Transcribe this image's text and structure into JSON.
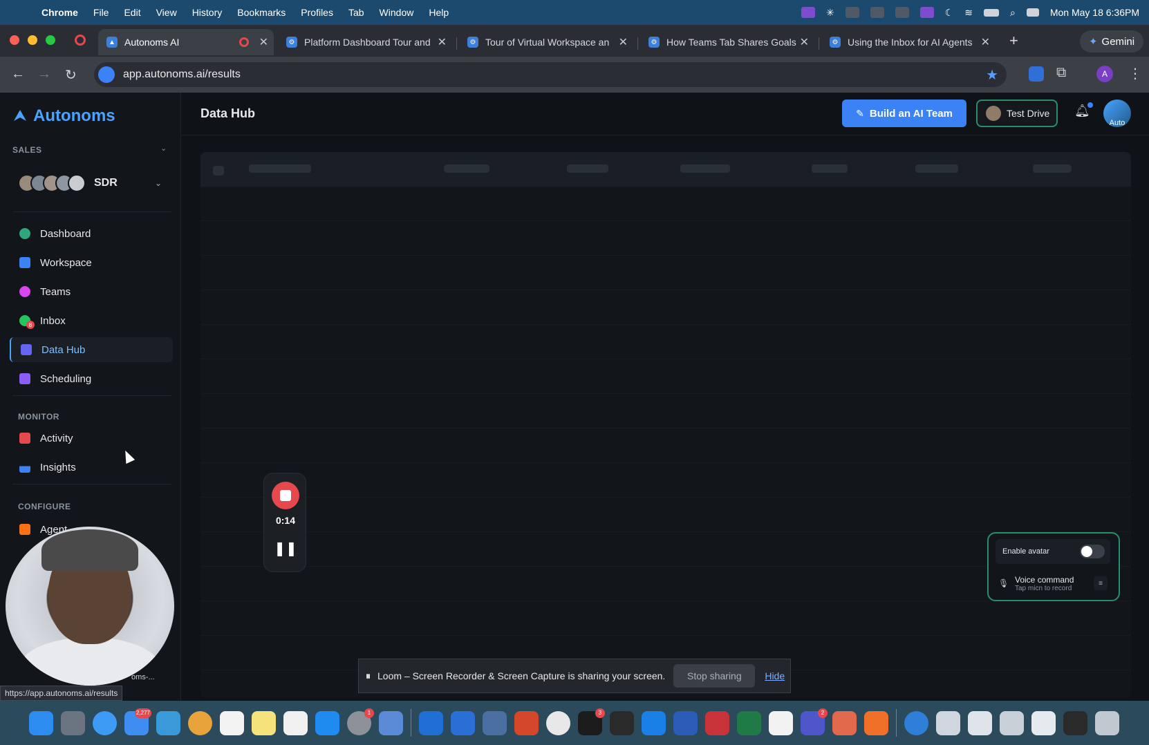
{
  "menubar": {
    "app": "Chrome",
    "items": [
      "File",
      "Edit",
      "View",
      "History",
      "Bookmarks",
      "Profiles",
      "Tab",
      "Window",
      "Help"
    ],
    "clock": "Mon May 18  6:36PM"
  },
  "tabs": [
    {
      "title": "Autonoms AI",
      "active": true
    },
    {
      "title": "Platform Dashboard Tour and",
      "active": false
    },
    {
      "title": "Tour of Virtual Workspace an",
      "active": false
    },
    {
      "title": "How Teams Tab Shares Goals",
      "active": false
    },
    {
      "title": "Using the Inbox for AI Agents",
      "active": false
    }
  ],
  "gemini_label": "Gemini",
  "address": {
    "url": "app.autonoms.ai/results"
  },
  "profile_initial": "A",
  "sidebar": {
    "brand": "Autonoms",
    "section_sales": "SALES",
    "team_name": "SDR",
    "items": [
      {
        "label": "Dashboard",
        "color": "#2ea77c"
      },
      {
        "label": "Workspace",
        "color": "#3b82f6"
      },
      {
        "label": "Teams",
        "color": "#d946ef"
      },
      {
        "label": "Inbox",
        "color": "#22c55e",
        "badge": "8"
      },
      {
        "label": "Data Hub",
        "color": "#6366f1"
      },
      {
        "label": "Scheduling",
        "color": "#8b5cf6"
      }
    ],
    "section_monitor": "MONITOR",
    "monitor_items": [
      {
        "label": "Activity",
        "color": "#e5484d"
      },
      {
        "label": "Insights",
        "color": "#3b82f6"
      }
    ],
    "section_configure": "CONFIGURE",
    "configure_items": [
      {
        "label": "Agent",
        "color": "#f97316"
      }
    ]
  },
  "header": {
    "title": "Data Hub",
    "build_label": "Build an AI Team",
    "test_label": "Test Drive",
    "user_av_label": "Auto"
  },
  "loom": {
    "time": "0:14"
  },
  "avatar_panel": {
    "enable_label": "Enable avatar",
    "voice_title": "Voice command",
    "voice_sub": "Tap micn to record"
  },
  "share_bar": {
    "message": "Loom – Screen Recorder & Screen Capture is sharing your screen.",
    "stop_label": "Stop sharing",
    "hide_label": "Hide"
  },
  "status_url": "https://app.autonoms.ai/results",
  "cam_label": "oms-...",
  "dock": {
    "badges": {
      "mail": "2,277",
      "settings": "1",
      "terminal": "3",
      "teams": "2"
    }
  }
}
